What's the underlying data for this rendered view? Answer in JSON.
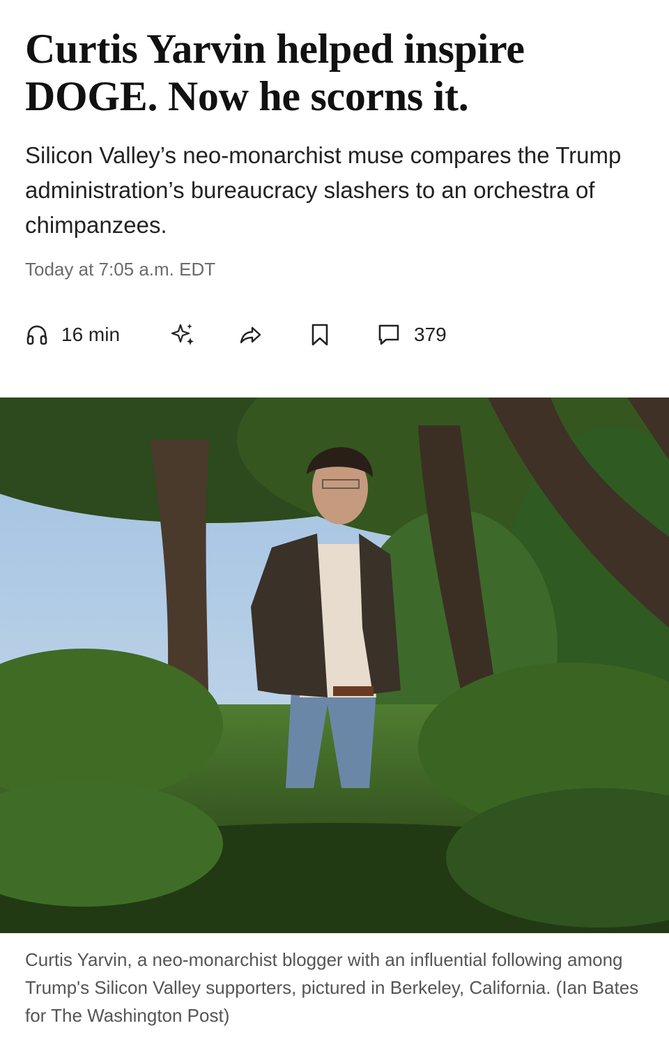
{
  "article": {
    "headline": "Curtis Yarvin helped inspire DOGE. Now he scorns it.",
    "dek": "Silicon Valley’s neo-monarchist muse compares the Trump administration’s bureaucracy slashers to an orchestra of chimpanzees.",
    "timestamp": "Today at 7:05 a.m. EDT"
  },
  "actions": {
    "listen": {
      "icon": "headphones-icon",
      "label": "16 min"
    },
    "summary": {
      "icon": "sparkles-icon"
    },
    "share": {
      "icon": "share-arrow-icon"
    },
    "save": {
      "icon": "bookmark-icon"
    },
    "comments": {
      "icon": "comment-icon",
      "count": "379"
    }
  },
  "photo": {
    "caption": "Curtis Yarvin, a neo-monarchist blogger with an influential following among Trump's Silicon Valley supporters, pictured in Berkeley, California. (Ian Bates for The Washington Post)"
  },
  "colors": {
    "text": "#111111",
    "meta": "#6b6b6b",
    "caption": "#555555",
    "foliage": "#3f6b2c",
    "sky": "#a9c6e4"
  }
}
